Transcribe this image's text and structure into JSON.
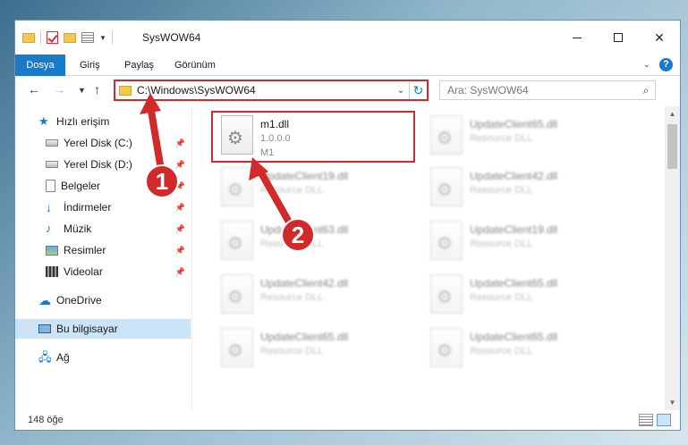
{
  "window": {
    "title": "SysWOW64",
    "quick_access_icons": [
      "folder-icon",
      "properties-check-icon",
      "folder-icon",
      "properties-icon",
      "dropdown-icon"
    ]
  },
  "ribbon": {
    "tabs": [
      {
        "label": "Dosya",
        "active": true
      },
      {
        "label": "Giriş"
      },
      {
        "label": "Paylaş"
      },
      {
        "label": "Görünüm"
      }
    ],
    "help": "?"
  },
  "nav": {
    "address": "C:\\Windows\\SysWOW64",
    "search_placeholder": "Ara: SysWOW64"
  },
  "nav_pane": {
    "items": [
      {
        "label": "Hızlı erişim",
        "icon": "star-icon"
      },
      {
        "label": "Yerel Disk (C:)",
        "icon": "disk-icon",
        "pinned": true
      },
      {
        "label": "Yerel Disk (D:)",
        "icon": "disk-icon",
        "pinned": true
      },
      {
        "label": "Belgeler",
        "icon": "document-icon",
        "pinned": true
      },
      {
        "label": "İndirmeler",
        "icon": "download-icon",
        "pinned": true
      },
      {
        "label": "Müzik",
        "icon": "music-icon",
        "pinned": true
      },
      {
        "label": "Resimler",
        "icon": "pictures-icon",
        "pinned": true
      },
      {
        "label": "Videolar",
        "icon": "video-icon",
        "pinned": true
      },
      {
        "label": "OneDrive",
        "icon": "cloud-icon"
      },
      {
        "label": "Bu bilgisayar",
        "icon": "computer-icon",
        "selected": true
      },
      {
        "label": "Ağ",
        "icon": "network-icon"
      }
    ]
  },
  "files": [
    {
      "name": "m1.dll",
      "line2": "1.0.0.0",
      "line3": "M1",
      "highlighted": true
    },
    {
      "name": "UpdateClient65.dll",
      "line2": "Resource DLL"
    },
    {
      "name": "UpdateClient19.dll",
      "line2": "Resource DLL"
    },
    {
      "name": "UpdateClient42.dll",
      "line2": "Resource DLL"
    },
    {
      "name": "UpdateClient63.dll",
      "line2": "Resource DLL"
    },
    {
      "name": "UpdateClient19.dll",
      "line2": "Resource DLL"
    },
    {
      "name": "UpdateClient42.dll",
      "line2": "Resource DLL"
    },
    {
      "name": "UpdateClient65.dll",
      "line2": "Resource DLL"
    },
    {
      "name": "UpdateClient65.dll",
      "line2": "Resource DLL"
    },
    {
      "name": "UpdateClient65.dll",
      "line2": "Resource DLL"
    }
  ],
  "status": {
    "count": "148 öğe"
  },
  "annotations": {
    "step1": "1",
    "step2": "2",
    "color": "#d02a2a"
  },
  "colors": {
    "accent": "#1979ca",
    "highlight": "#d02a2a",
    "selected_bg": "#cce4f7"
  }
}
